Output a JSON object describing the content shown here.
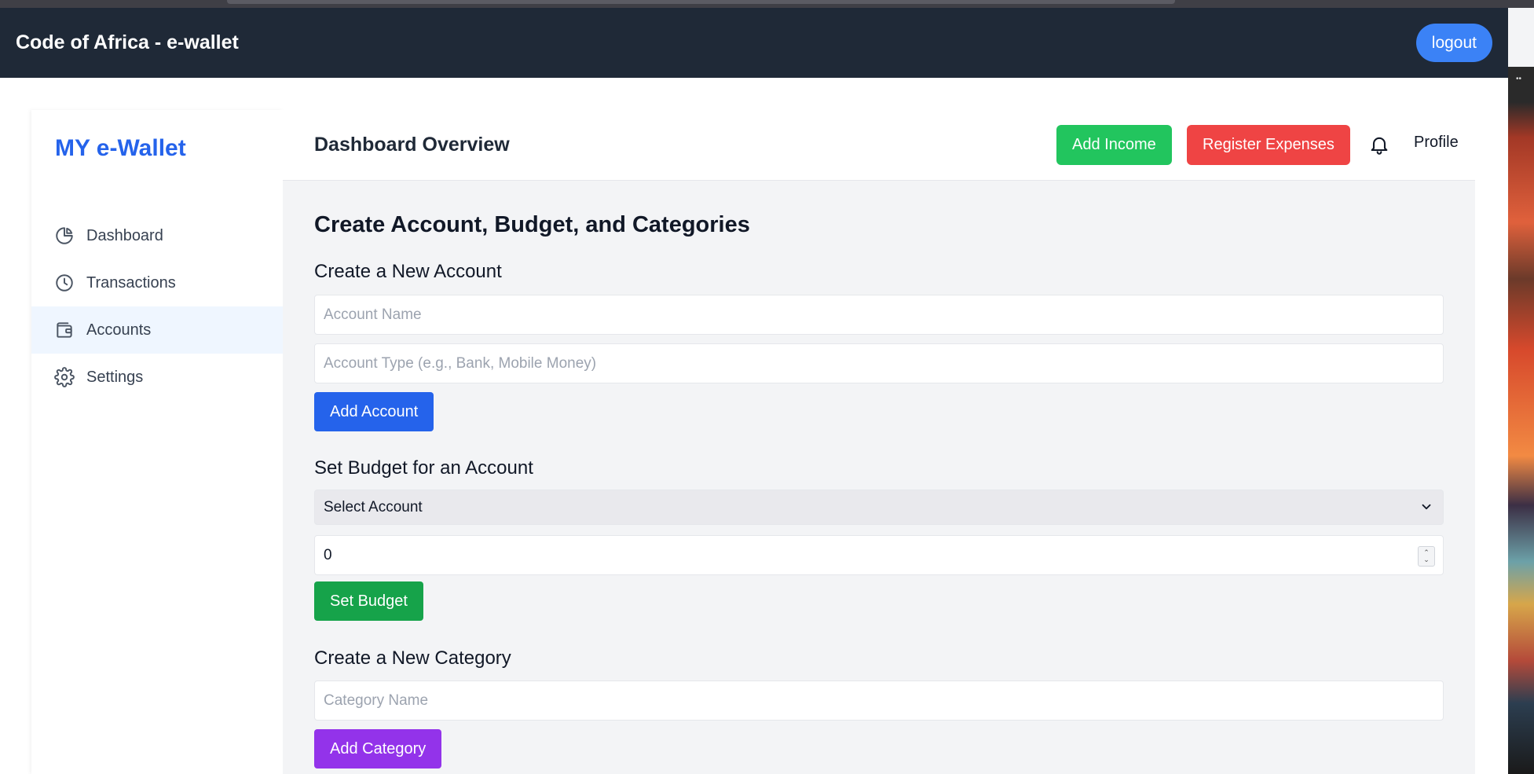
{
  "topbar": {
    "brand": "Code of Africa - e-wallet",
    "logout_label": "logout"
  },
  "sidebar": {
    "title": "MY e-Wallet",
    "items": [
      {
        "label": "Dashboard",
        "icon": "pie-chart-icon",
        "active": false
      },
      {
        "label": "Transactions",
        "icon": "clock-icon",
        "active": false
      },
      {
        "label": "Accounts",
        "icon": "wallet-icon",
        "active": true
      },
      {
        "label": "Settings",
        "icon": "gear-icon",
        "active": false
      }
    ]
  },
  "header": {
    "title": "Dashboard Overview",
    "add_income_label": "Add Income",
    "register_expenses_label": "Register Expenses",
    "bell_icon": "bell-icon",
    "profile_label": "Profile"
  },
  "content": {
    "section_title": "Create Account, Budget, and Categories",
    "account": {
      "title": "Create a New Account",
      "name_placeholder": "Account Name",
      "name_value": "",
      "type_placeholder": "Account Type (e.g., Bank, Mobile Money)",
      "type_value": "",
      "button_label": "Add Account"
    },
    "budget": {
      "title": "Set Budget for an Account",
      "select_value": "Select Account",
      "amount_value": "0",
      "button_label": "Set Budget"
    },
    "category": {
      "title": "Create a New Category",
      "name_placeholder": "Category Name",
      "name_value": "",
      "button_label": "Add Category"
    }
  },
  "colors": {
    "topbar_bg": "#1f2937",
    "brand_blue": "#2563eb",
    "logout_blue": "#3b82f6",
    "income_green": "#22c55e",
    "expense_red": "#ef4444",
    "budget_green": "#16a34a",
    "category_purple": "#9333ea",
    "active_nav_bg": "#eff6ff"
  }
}
